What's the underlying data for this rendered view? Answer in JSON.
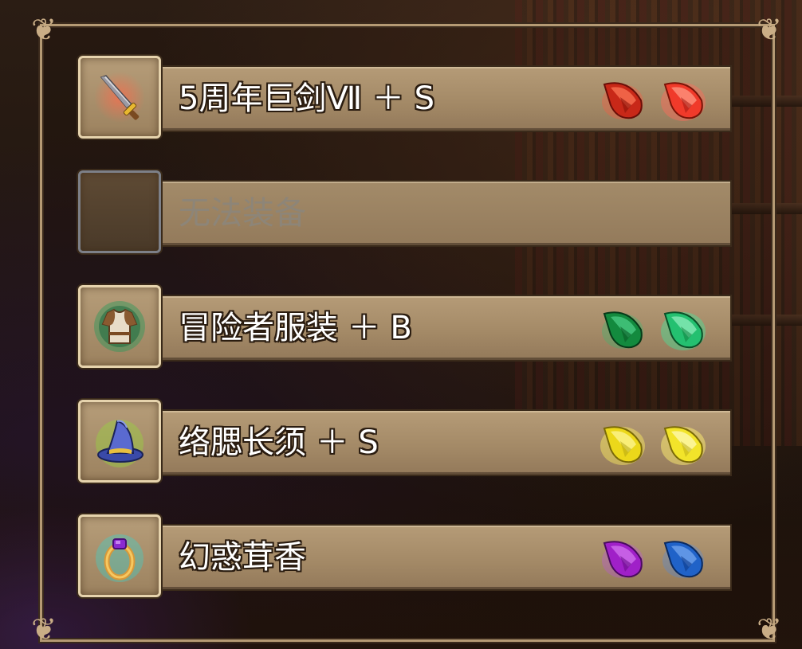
{
  "equipment": {
    "slots": [
      {
        "label": "5周年巨剑Ⅶ ＋ S",
        "icon": "sword-icon",
        "enabled": true,
        "gems": [
          {
            "icon": "gem-icon",
            "color": "#e0301f"
          },
          {
            "icon": "gem-icon",
            "color": "#ff4a3a"
          }
        ]
      },
      {
        "label": "无法装备",
        "icon": "empty-slot",
        "enabled": false,
        "gems": []
      },
      {
        "label": "冒险者服装 ＋ B",
        "icon": "armor-icon",
        "enabled": true,
        "gems": [
          {
            "icon": "gem-icon",
            "color": "#18a04a"
          },
          {
            "icon": "gem-icon",
            "color": "#2fd07a"
          }
        ]
      },
      {
        "label": "络腮长须 ＋ S",
        "icon": "wizard-hat-icon",
        "enabled": true,
        "gems": [
          {
            "icon": "gem-icon",
            "color": "#f2e020"
          },
          {
            "icon": "gem-icon",
            "color": "#f7ea3a"
          }
        ]
      },
      {
        "label": "幻惑茸香",
        "icon": "ring-icon",
        "enabled": true,
        "gems": [
          {
            "icon": "gem-icon",
            "color": "#b02ad0"
          },
          {
            "icon": "gem-icon",
            "color": "#2a6fd6"
          }
        ]
      }
    ]
  },
  "colors": {
    "frame": "#b59a74",
    "bar": "#a48a67",
    "text": "#ffffff",
    "disabled_text": "#8d8578"
  }
}
